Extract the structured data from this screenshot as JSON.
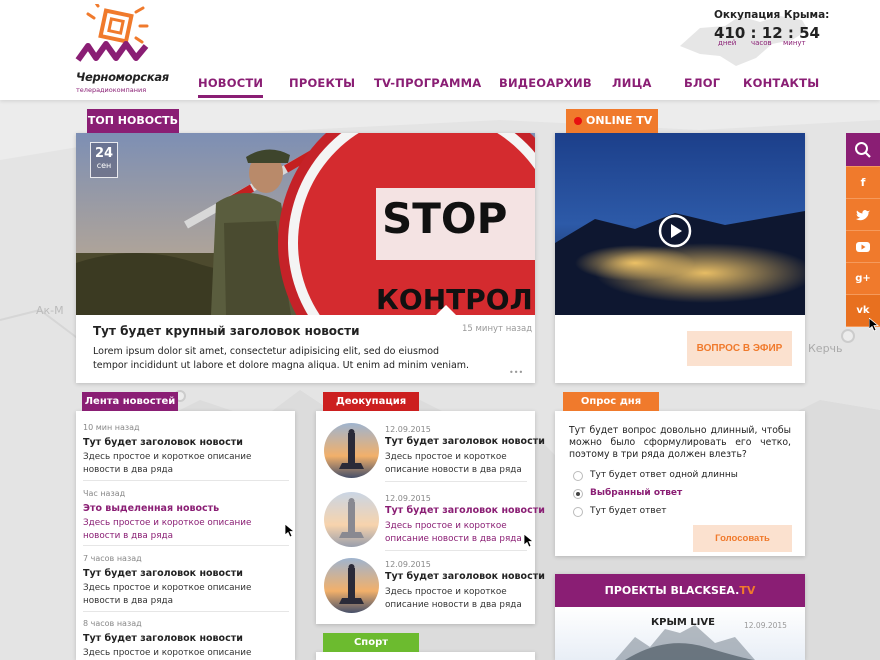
{
  "brand": {
    "name": "Черноморская",
    "subtitle": "телерадиокомпания"
  },
  "nav": [
    {
      "label": "НОВОСТИ",
      "active": true
    },
    {
      "label": "ПРОЕКТЫ"
    },
    {
      "label": "TV-ПРОГРАММА"
    },
    {
      "label": "ВИДЕОАРХИВ"
    },
    {
      "label": "ЛИЦА"
    },
    {
      "label": "БЛОГ"
    },
    {
      "label": "КОНТАКТЫ"
    }
  ],
  "occupation": {
    "title": "Оккупация Крыма:",
    "days": "410",
    "sep1": ":",
    "hours": "12",
    "sep2": ":",
    "minutes": "54",
    "days_label": "дней",
    "hours_label": "часов",
    "minutes_label": "минут"
  },
  "top_news": {
    "tag": "ТОП НОВОСТЬ",
    "date_day": "24",
    "date_month": "сен",
    "title": "Тут будет крупный заголовок новости",
    "time": "15 минут назад",
    "text": "Lorem ipsum dolor sit amet, consectetur adipisicing elit, sed do eiusmod tempor incididunt ut labore et dolore magna aliqua. Ut enim ad minim veniam.",
    "more": "•••"
  },
  "online_tv": {
    "tag": "ONLINE TV",
    "button": "ВОПРОС В ЭФИР"
  },
  "feed": {
    "tag": "Лента новостей",
    "items": [
      {
        "time": "10 мин назад",
        "title": "Тут будет заголовок новости",
        "desc": "Здесь простое и короткое описание новости в два ряда"
      },
      {
        "time": "Час назад",
        "title": "Это выделенная новость",
        "desc": "Здесь простое и короткое описание новости в два ряда"
      },
      {
        "time": "7 часов назад",
        "title": "Тут будет заголовок новости",
        "desc": "Здесь простое и короткое описание новости в два ряда"
      },
      {
        "time": "8 часов назад",
        "title": "Тут будет заголовок новости",
        "desc": "Здесь простое и короткое описание новости в два ряда"
      }
    ]
  },
  "deoccupation": {
    "tag": "Деокупация",
    "items": [
      {
        "date": "12.09.2015",
        "title": "Тут будет заголовок новости",
        "desc": "Здесь простое и короткое описание новости в два ряда"
      },
      {
        "date": "12.09.2015",
        "title": "Тут будет заголовок новости",
        "desc": "Здесь простое и короткое описание новости в два ряда"
      },
      {
        "date": "12.09.2015",
        "title": "Тут будет заголовок новости",
        "desc": "Здесь простое и короткое описание новости в два ряда"
      }
    ]
  },
  "sport": {
    "tag": "Спорт"
  },
  "poll": {
    "tag": "Опрос дня",
    "question": "Тут будет вопрос довольно длинный, чтобы можно было сформулировать его четко, поэтому в три ряда должен влезть?",
    "options": [
      {
        "label": "Тут будет ответ одной длинны",
        "selected": false
      },
      {
        "label": "Выбранный ответ",
        "selected": true
      },
      {
        "label": "Тут будет ответ",
        "selected": false
      }
    ],
    "button": "Голосовать"
  },
  "projects": {
    "header_prefix": "ПРОЕКТЫ BLACKSEA.",
    "header_suffix": "TV",
    "item_title": "КРЫМ LIVE",
    "item_date": "12.09.2015"
  },
  "social": {
    "items": [
      {
        "icon": "search-icon",
        "label": ""
      },
      {
        "icon": "facebook-icon",
        "label": "f"
      },
      {
        "icon": "twitter-icon",
        "label": ""
      },
      {
        "icon": "youtube-icon",
        "label": ""
      },
      {
        "icon": "googleplus-icon",
        "label": "g+"
      },
      {
        "icon": "vk-icon",
        "label": "vk"
      }
    ]
  },
  "map_labels": {
    "kerch": "Керчь",
    "ak": "Ак-М"
  },
  "colors": {
    "purple": "#8a1e74",
    "orange": "#f07a2c",
    "red": "#cc1f1f",
    "green": "#6cbb2f",
    "peach": "#fbe1cf"
  }
}
